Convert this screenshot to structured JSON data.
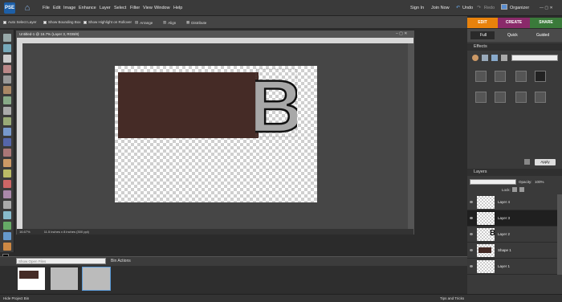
{
  "app": {
    "logo": "PSE"
  },
  "menu": [
    "File",
    "Edit",
    "Image",
    "Enhance",
    "Layer",
    "Select",
    "Filter",
    "View",
    "Window",
    "Help"
  ],
  "topright": {
    "signin": "Sign In",
    "join": "Join Now",
    "undo": "Undo",
    "redo": "Redo",
    "organizer": "Organizer"
  },
  "options": {
    "auto_select": "Auto Select Layer",
    "bounding_box": "Show Bounding Box",
    "highlight": "Show Highlight on Rollover",
    "arrange": "Arrange",
    "align": "Align",
    "distribute": "Distribute"
  },
  "tabs": {
    "edit": "EDIT",
    "create": "CREATE",
    "share": "SHARE"
  },
  "viewmodes": {
    "full": "Full",
    "quick": "Quick",
    "guided": "Guided"
  },
  "document": {
    "title": "Untitled-1 @ 16.7% (Layer 3, RGB/8)",
    "zoom": "16.67%",
    "info": "11.5 inches x 8 inches (300 ppi)"
  },
  "canvas_letter": "B",
  "effects": {
    "header": "Effects",
    "apply": "Apply"
  },
  "layers": {
    "header": "Layers",
    "opacity_label": "Opacity:",
    "opacity_value": "100%",
    "lock_label": "Lock:",
    "items": [
      {
        "name": "Layer 4"
      },
      {
        "name": "Layer 3"
      },
      {
        "name": "Layer 2"
      },
      {
        "name": "Shape 1"
      },
      {
        "name": "Layer 1"
      }
    ]
  },
  "bin": {
    "show": "Show Open Files",
    "actions": "Bin Actions",
    "hide": "Hide Project Bin"
  },
  "tips": "Tips and Tricks",
  "colors": {
    "accent_edit": "#e8820c",
    "accent_create": "#8a2a6a",
    "accent_share": "#3a7a3a",
    "shape_brown": "#452b26"
  }
}
